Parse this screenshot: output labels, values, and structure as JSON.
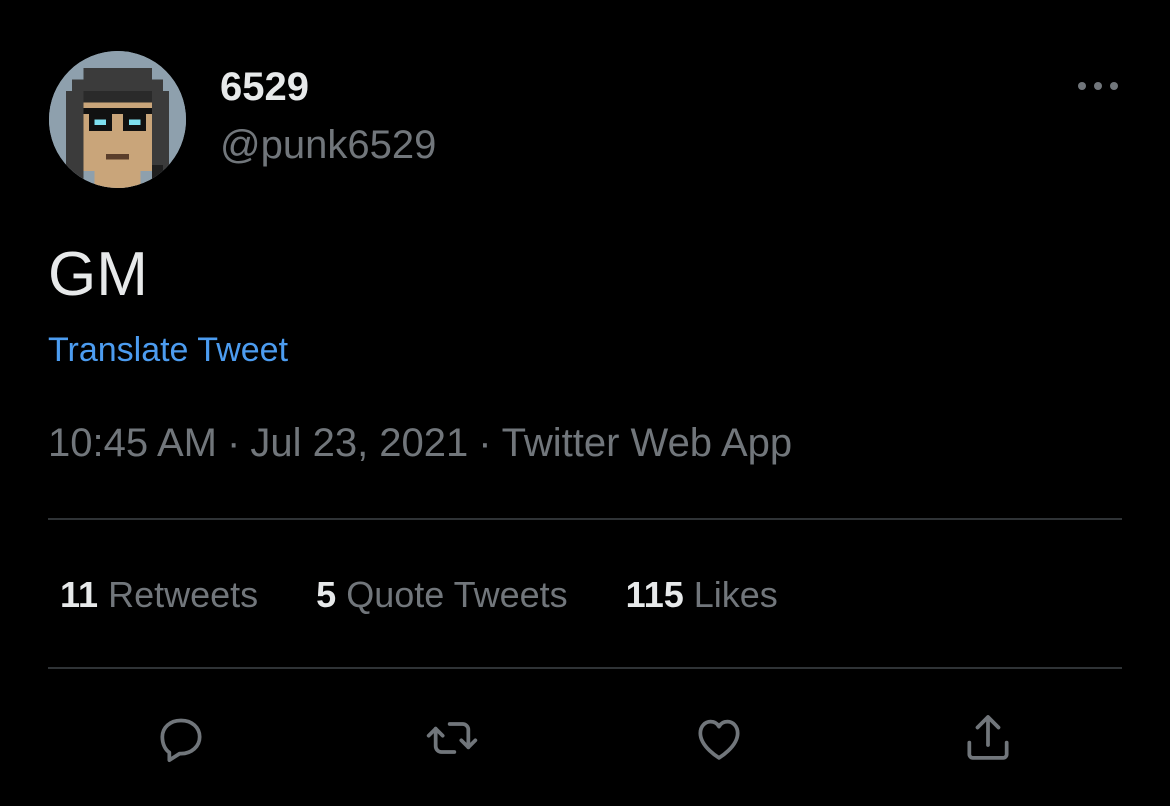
{
  "author": {
    "display_name": "6529",
    "handle": "@punk6529",
    "avatar_icon": "pixel-punk-avatar"
  },
  "tweet": {
    "text": "GM",
    "translate_label": "Translate Tweet",
    "time": "10:45 AM",
    "separator": "·",
    "date": "Jul 23, 2021",
    "source": "Twitter Web App"
  },
  "stats": {
    "retweets_count": "11",
    "retweets_label": "Retweets",
    "quotes_count": "5",
    "quotes_label": "Quote Tweets",
    "likes_count": "115",
    "likes_label": "Likes"
  },
  "actions": {
    "reply_icon": "reply-icon",
    "retweet_icon": "retweet-icon",
    "like_icon": "heart-icon",
    "share_icon": "share-icon"
  },
  "colors": {
    "background": "#000000",
    "primary_text": "#e7e9ea",
    "secondary_text": "#71767b",
    "link": "#4c9cf0",
    "divider": "#2f3336"
  }
}
